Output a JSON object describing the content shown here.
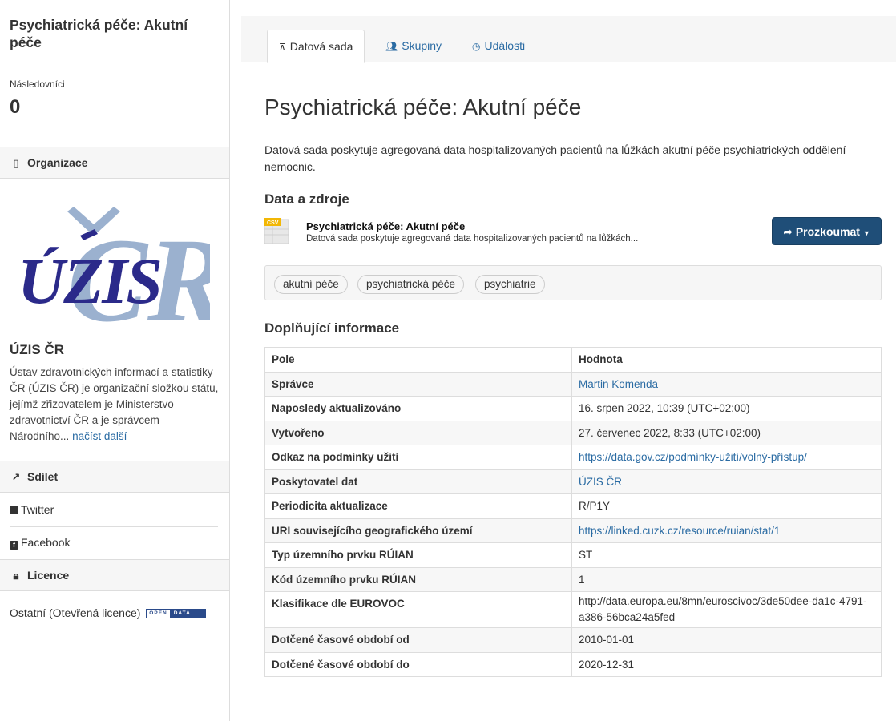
{
  "sidebar": {
    "title": "Psychiatrická péče: Akutní péče",
    "followers_label": "Následovníci",
    "followers_count": "0",
    "organization_heading": "Organizace",
    "org_logo_text": "ÚZIS ČR",
    "org_name": "ÚZIS ČR",
    "org_description": "Ústav zdravotnických informací a statistiky ČR (ÚZIS ČR) je organizační složkou státu, jejímž zřizovatelem je Ministerstvo zdravotnictví ČR a je správcem Národního...",
    "read_more": "načíst další",
    "share_heading": "Sdílet",
    "twitter": "Twitter",
    "facebook": "Facebook",
    "licence_heading": "Licence",
    "licence_text": "Ostatní (Otevřená licence)",
    "open_data_badge": {
      "open": "OPEN",
      "data": "DATA"
    }
  },
  "tabs": [
    {
      "label": "Datová sada",
      "icon": "sitemap-icon",
      "active": true
    },
    {
      "label": "Skupiny",
      "icon": "users-icon",
      "active": false
    },
    {
      "label": "Události",
      "icon": "clock-icon",
      "active": false
    }
  ],
  "main": {
    "title": "Psychiatrická péče: Akutní péče",
    "description": "Datová sada poskytuje agregovaná data hospitalizovaných pacientů na lůžkách akutní péče psychiatrických oddělení nemocnic.",
    "resources_heading": "Data a zdroje",
    "resource": {
      "format": "CSV",
      "title": "Psychiatrická péče: Akutní péče",
      "description": "Datová sada poskytuje agregovaná data hospitalizovaných pacientů na lůžkách...",
      "explore_label": "Prozkoumat"
    },
    "tags": [
      "akutní péče",
      "psychiatrická péče",
      "psychiatrie"
    ],
    "additional_heading": "Doplňující informace",
    "table": {
      "headers": [
        "Pole",
        "Hodnota"
      ],
      "rows": [
        {
          "key": "Správce",
          "value": "Martin Komenda",
          "link": true
        },
        {
          "key": "Naposledy aktualizováno",
          "value": "16. srpen 2022, 10:39 (UTC+02:00)",
          "link": false
        },
        {
          "key": "Vytvořeno",
          "value": "27. červenec 2022, 8:33 (UTC+02:00)",
          "link": false
        },
        {
          "key": "Odkaz na podmínky užití",
          "value": "https://data.gov.cz/podmínky-užití/volný-přístup/",
          "link": true
        },
        {
          "key": "Poskytovatel dat",
          "value": "ÚZIS ČR",
          "link": true
        },
        {
          "key": "Periodicita aktualizace",
          "value": "R/P1Y",
          "link": false
        },
        {
          "key": "URI souvisejícího geografického území",
          "value": "https://linked.cuzk.cz/resource/ruian/stat/1",
          "link": true
        },
        {
          "key": "Typ územního prvku RÚIAN",
          "value": "ST",
          "link": false
        },
        {
          "key": "Kód územního prvku RÚIAN",
          "value": "1",
          "link": false
        },
        {
          "key": "Klasifikace dle EUROVOC",
          "value": "http://data.europa.eu/8mn/euroscivoc/3de50dee-da1c-4791-a386-56bca24a5fed",
          "link": false
        },
        {
          "key": "Dotčené časové období od",
          "value": "2010-01-01",
          "link": false
        },
        {
          "key": "Dotčené časové období do",
          "value": "2020-12-31",
          "link": false
        }
      ]
    }
  },
  "colors": {
    "link": "#2a6ba3",
    "button": "#1f4e78",
    "logo_light": "#9bb1cf",
    "logo_dark": "#2b2a8a"
  }
}
